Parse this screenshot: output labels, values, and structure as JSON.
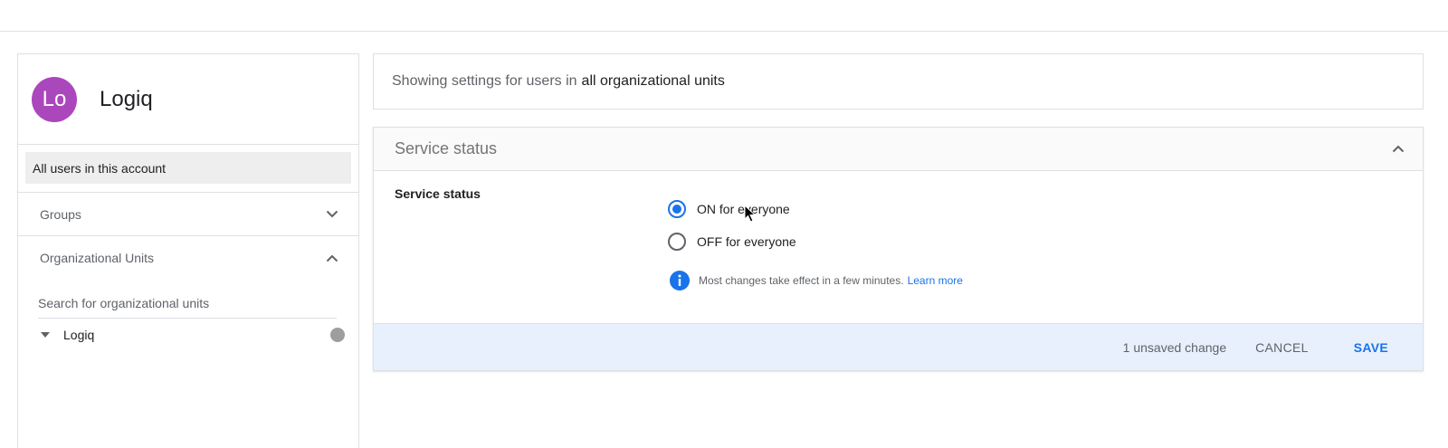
{
  "org": {
    "avatar_initials": "Lo",
    "name": "Logiq",
    "avatar_color": "#ab47bc"
  },
  "sidebar": {
    "all_users_label": "All users in this account",
    "groups_label": "Groups",
    "org_units_label": "Organizational Units",
    "search": {
      "placeholder": "Search for organizational units",
      "value": ""
    },
    "tree": [
      {
        "label": "Logiq"
      }
    ]
  },
  "info_bar": {
    "prefix": "Showing settings for users in",
    "scope": "all organizational units"
  },
  "card": {
    "title": "Service status",
    "setting_label": "Service status",
    "options": [
      {
        "label": "ON for everyone",
        "selected": true
      },
      {
        "label": "OFF for everyone",
        "selected": false
      }
    ],
    "note": "Most changes take effect in a few minutes.",
    "learn_more": "Learn more"
  },
  "footer": {
    "unsaved_text": "1 unsaved change",
    "cancel_label": "CANCEL",
    "save_label": "SAVE"
  },
  "colors": {
    "accent": "#1a73e8",
    "footer_bg": "#e8f0fe"
  },
  "icons": {
    "groups_chevron": "chevron-down-icon",
    "ou_chevron": "chevron-up-icon",
    "card_chevron": "chevron-up-icon",
    "tree_caret": "caret-down-icon",
    "note_icon": "info-icon"
  }
}
